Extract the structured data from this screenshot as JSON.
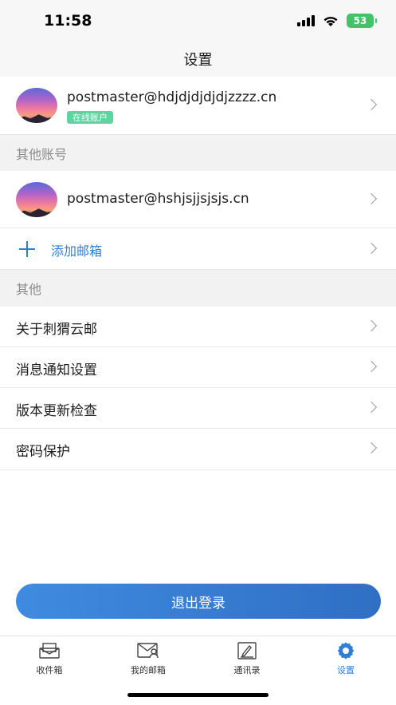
{
  "status_bar": {
    "time": "11:58",
    "battery": "53"
  },
  "nav": {
    "title": "设置"
  },
  "current_account": {
    "email": "postmaster@hdjdjdjdjdjzzzz.cn",
    "badge": "在线账户"
  },
  "sections": {
    "other_accounts": "其他账号",
    "others": "其他"
  },
  "other_accounts": [
    {
      "email": "postmaster@hshjsjjsjsjs.cn"
    }
  ],
  "add_mailbox": {
    "label": "添加邮箱"
  },
  "menu_items": [
    {
      "label": "关于刺猬云邮"
    },
    {
      "label": "消息通知设置"
    },
    {
      "label": "版本更新检查"
    },
    {
      "label": "密码保护"
    }
  ],
  "logout": {
    "label": "退出登录"
  },
  "tabs": [
    {
      "label": "收件箱",
      "icon": "inbox-icon"
    },
    {
      "label": "我的邮箱",
      "icon": "mailbox-user-icon"
    },
    {
      "label": "通讯录",
      "icon": "contacts-icon"
    },
    {
      "label": "设置",
      "icon": "gear-icon",
      "active": true
    }
  ],
  "colors": {
    "accent": "#2f7fd9",
    "badge": "#5cd6a0",
    "battery": "#42c36a"
  }
}
